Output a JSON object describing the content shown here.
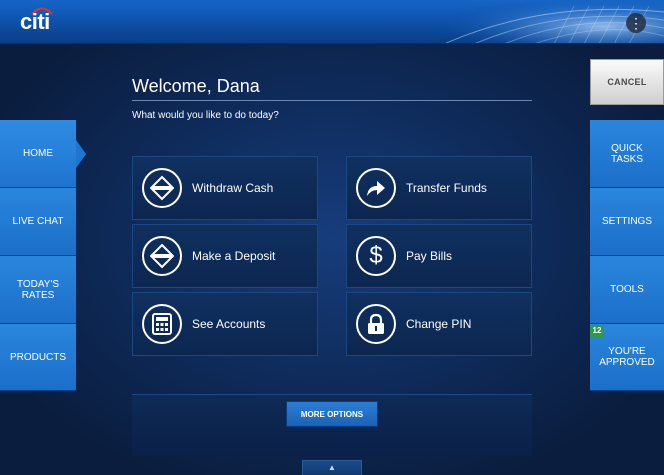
{
  "header": {
    "logo_text": "citi",
    "menu_icon": "more-vert-icon"
  },
  "welcome": {
    "title": "Welcome, Dana",
    "prompt": "What would you like to do today?"
  },
  "left_nav": [
    {
      "label": "HOME",
      "active": true
    },
    {
      "label": "LIVE CHAT"
    },
    {
      "label": "TODAY'S RATES"
    },
    {
      "label": "PRODUCTS"
    }
  ],
  "right_nav": {
    "cancel_label": "CANCEL",
    "items": [
      {
        "label": "QUICK TASKS"
      },
      {
        "label": "SETTINGS"
      },
      {
        "label": "TOOLS"
      },
      {
        "label": "YOU'RE APPROVED",
        "badge": "12"
      }
    ]
  },
  "actions": [
    {
      "label": "Withdraw Cash",
      "icon": "up-down-arrows-icon"
    },
    {
      "label": "Transfer Funds",
      "icon": "forward-arrow-icon"
    },
    {
      "label": "Make a Deposit",
      "icon": "up-down-arrows-icon"
    },
    {
      "label": "Pay Bills",
      "icon": "dollar-icon"
    },
    {
      "label": "See Accounts",
      "icon": "calculator-icon"
    },
    {
      "label": "Change PIN",
      "icon": "lock-icon"
    }
  ],
  "more_options_label": "MORE OPTIONS",
  "handle_glyph": "▲",
  "colors": {
    "accent": "#1b6fc9",
    "background": "#0a1d3e",
    "tile": "#10305f",
    "badge": "#2d9a4a"
  }
}
